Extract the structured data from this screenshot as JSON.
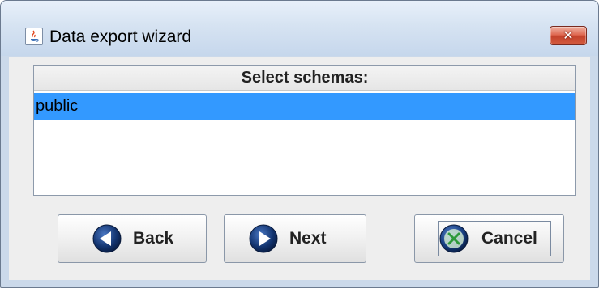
{
  "window": {
    "title": "Data export wizard",
    "app_icon": "java-coffee-icon",
    "close_icon": "close-icon",
    "close_glyph": "✕"
  },
  "schemas": {
    "header": "Select schemas:",
    "items": [
      {
        "label": "public",
        "selected": true
      }
    ]
  },
  "buttons": {
    "back": {
      "label": "Back",
      "icon": "arrow-left-icon"
    },
    "next": {
      "label": "Next",
      "icon": "arrow-right-icon"
    },
    "cancel": {
      "label": "Cancel",
      "icon": "cancel-x-icon"
    }
  },
  "colors": {
    "selection": "#3399ff",
    "titlebar": "#d6e3f2",
    "close_button": "#c4432b",
    "panel_bg": "#eeeeee"
  }
}
